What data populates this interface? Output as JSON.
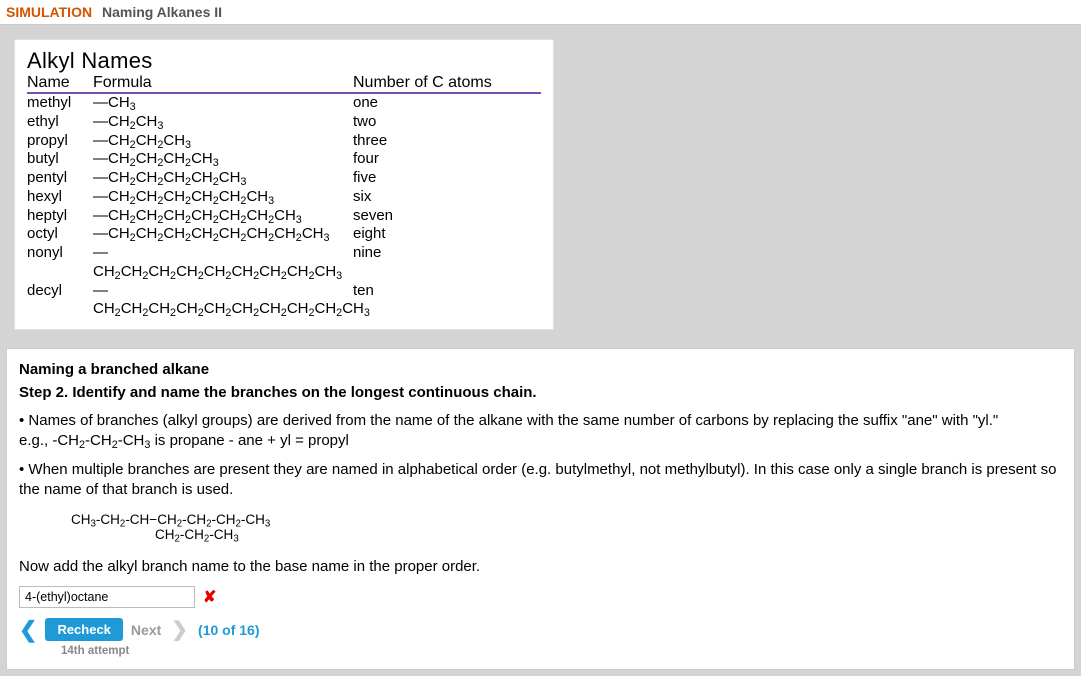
{
  "header": {
    "sim_label": "SIMULATION",
    "title": "Naming Alkanes II"
  },
  "reference": {
    "title": "Alkyl Names",
    "cols": {
      "name": "Name",
      "formula": "Formula",
      "c": "Number of C atoms"
    },
    "rows": [
      {
        "name": "methyl",
        "formula_html": "—CH<sub>3</sub>",
        "c": "one"
      },
      {
        "name": "ethyl",
        "formula_html": "—CH<sub>2</sub>CH<sub>3</sub>",
        "c": "two"
      },
      {
        "name": "propyl",
        "formula_html": "—CH<sub>2</sub>CH<sub>2</sub>CH<sub>3</sub>",
        "c": "three"
      },
      {
        "name": "butyl",
        "formula_html": "—CH<sub>2</sub>CH<sub>2</sub>CH<sub>2</sub>CH<sub>3</sub>",
        "c": "four"
      },
      {
        "name": "pentyl",
        "formula_html": "—CH<sub>2</sub>CH<sub>2</sub>CH<sub>2</sub>CH<sub>2</sub>CH<sub>3</sub>",
        "c": "five"
      },
      {
        "name": "hexyl",
        "formula_html": "—CH<sub>2</sub>CH<sub>2</sub>CH<sub>2</sub>CH<sub>2</sub>CH<sub>2</sub>CH<sub>3</sub>",
        "c": "six"
      },
      {
        "name": "heptyl",
        "formula_html": "—CH<sub>2</sub>CH<sub>2</sub>CH<sub>2</sub>CH<sub>2</sub>CH<sub>2</sub>CH<sub>2</sub>CH<sub>3</sub>",
        "c": "seven"
      },
      {
        "name": "octyl",
        "formula_html": "—CH<sub>2</sub>CH<sub>2</sub>CH<sub>2</sub>CH<sub>2</sub>CH<sub>2</sub>CH<sub>2</sub>CH<sub>2</sub>CH<sub>3</sub>",
        "c": "eight"
      },
      {
        "name": "nonyl",
        "formula_html": "—CH<sub>2</sub>CH<sub>2</sub>CH<sub>2</sub>CH<sub>2</sub>CH<sub>2</sub>CH<sub>2</sub>CH<sub>2</sub>CH<sub>2</sub>CH<sub>3</sub>",
        "c": "nine"
      },
      {
        "name": "decyl",
        "formula_html": "—CH<sub>2</sub>CH<sub>2</sub>CH<sub>2</sub>CH<sub>2</sub>CH<sub>2</sub>CH<sub>2</sub>CH<sub>2</sub>CH<sub>2</sub>CH<sub>2</sub>CH<sub>3</sub>",
        "c": "ten"
      }
    ]
  },
  "content": {
    "section_title": "Naming a branched alkane",
    "step_title": "Step 2. Identify and name the branches on the longest continuous chain.",
    "para1_html": "• Names of branches (alkyl groups) are derived from the name of the alkane with the same number of carbons by replacing the suffix \"ane\" with \"yl.\"<br>e.g., -CH<sub>2</sub>-CH<sub>2</sub>-CH<sub>3</sub> is propane - ane + yl = propyl",
    "para2": "• When multiple branches are present they are named in alphabetical order (e.g. butylmethyl, not methylbutyl). In this case only a single branch is present so the name of that branch is used.",
    "molecule_main_html": "CH<sub>3</sub>-CH<sub>2</sub>-CH−CH<sub>2</sub>-CH<sub>2</sub>-CH<sub>2</sub>-CH<sub>3</sub>",
    "molecule_branch_html": "CH<sub>2</sub>-CH<sub>2</sub>-CH<sub>3</sub>",
    "prompt": "Now add the alkyl branch name to the base name in the proper order.",
    "answer_value": "4-(ethyl)octane",
    "wrong_mark": "✘"
  },
  "nav": {
    "recheck": "Recheck",
    "next": "Next",
    "progress": "(10 of 16)",
    "attempt": "14th attempt"
  }
}
